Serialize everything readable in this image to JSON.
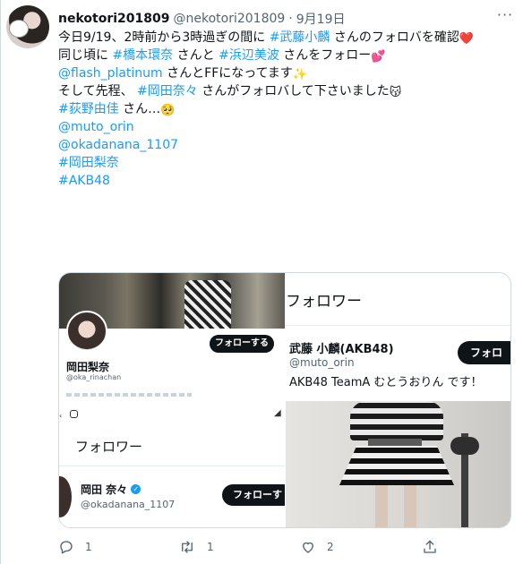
{
  "user": {
    "name": "nekotori201809",
    "handle": "@nekotori201809",
    "dot": "·",
    "time": "9月19日",
    "avatar_caption": ""
  },
  "more_icon": "more-dots-icon",
  "tweet": {
    "l1_pre": "今日9/19、2時前から3時過ぎの間に ",
    "l1_tag": "#武藤小麟",
    "l1_post": " さんのフォロバを確認",
    "l2_pre": "同じ頃に ",
    "l2_tag1": "#橋本環奈",
    "l2_mid": " さんと ",
    "l2_tag2": "#浜辺美波",
    "l2_post": " さんをフォロー",
    "l3_tag": "@flash_platinum",
    "l3_post": " さんとFFになってます",
    "l4_pre": "そして先程、 ",
    "l4_tag": "#岡田奈々",
    "l4_post": " さんがフォロバして下さいました",
    "l5_tag": "#荻野由佳",
    "l5_post": " さん…",
    "tags": [
      "@muto_orin",
      "@okadanana_1107",
      "#岡田梨奈",
      "#AKB48"
    ]
  },
  "media": {
    "panel1": {
      "follow_label": "フォローする",
      "name": "岡田梨奈",
      "handle": "@oka_rinachan"
    },
    "panel2": {
      "title": "フォロワー",
      "name": "岡田 奈々",
      "handle": "@okadanana_1107",
      "follow_label": "フォローす"
    },
    "panel3": {
      "title": "フォロワー",
      "name": "武藤 小麟(AKB48)",
      "handle": "@muto_orin",
      "bio": "AKB48 TeamA むとうおりん です！",
      "follow_label": "フォロ"
    }
  },
  "actions": {
    "reply_count": "1",
    "retweet_count": "1",
    "like_count": "2"
  }
}
